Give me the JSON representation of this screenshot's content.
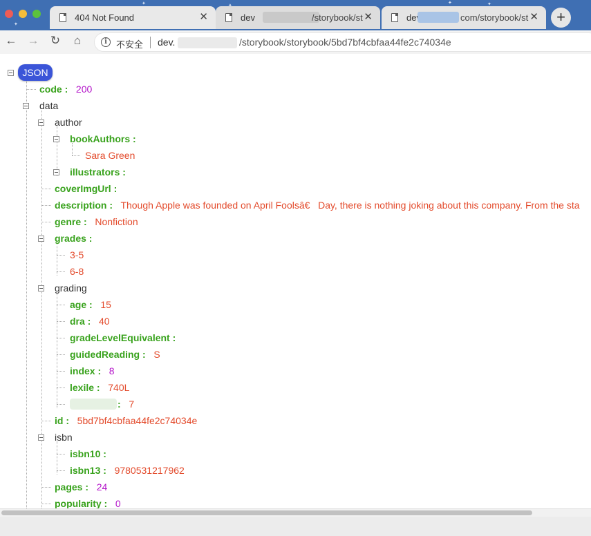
{
  "browser": {
    "tabs": [
      {
        "title": "404 Not Found",
        "active": false
      },
      {
        "title_start": "dev",
        "title_end": "/storybook/st",
        "active": false
      },
      {
        "title_start": "dev",
        "title_end": "com/storybook/st",
        "active": true
      }
    ],
    "new_tab_label": "+",
    "nav": {
      "back": "←",
      "forward": "→",
      "reload": "↻",
      "home": "⌂"
    },
    "address": {
      "security_icon": "i",
      "security_label": "不安全",
      "url_host_start": "dev.",
      "url_path": "/storybook/storybook/5bd7bf4cbfaa44fe2c74034e"
    }
  },
  "json_viewer": {
    "root_label": "JSON",
    "code_key": "code :",
    "code_value": "200",
    "data_key": "data",
    "author_key": "author",
    "book_authors_key": "bookAuthors :",
    "book_author_0": "Sara Green",
    "illustrators_key": "illustrators :",
    "cover_img_url_key": "coverImgUrl :",
    "description_key": "description :",
    "description_value": "Though Apple was founded on April Foolsâ€   Day, there is nothing joking about this company. From the sta",
    "genre_key": "genre :",
    "genre_value": "Nonfiction",
    "grades_key": "grades :",
    "grade_0": "3-5",
    "grade_1": "6-8",
    "grading_key": "grading",
    "age_key": "age :",
    "age_value": "15",
    "dra_key": "dra :",
    "dra_value": "40",
    "grade_level_equivalent_key": "gradeLevelEquivalent :",
    "guided_reading_key": "guidedReading :",
    "guided_reading_value": "S",
    "index_key": "index :",
    "index_value": "8",
    "lexile_key": "lexile :",
    "lexile_value": "740L",
    "redacted_key_suffix": ":",
    "redacted_value": "7",
    "id_key": "id :",
    "id_value": "5bd7bf4cbfaa44fe2c74034e",
    "isbn_key": "isbn",
    "isbn10_key": "isbn10 :",
    "isbn13_key": "isbn13 :",
    "isbn13_value": "9780531217962",
    "pages_key": "pages :",
    "pages_value": "24",
    "popularity_key": "popularity :",
    "popularity_value": "0"
  },
  "colors": {
    "titlebar": "#3f6fb3",
    "root_badge": "#3b55d8",
    "key_green": "#38a21c",
    "string_red": "#e34a2b",
    "number_purple": "#b314c9"
  }
}
